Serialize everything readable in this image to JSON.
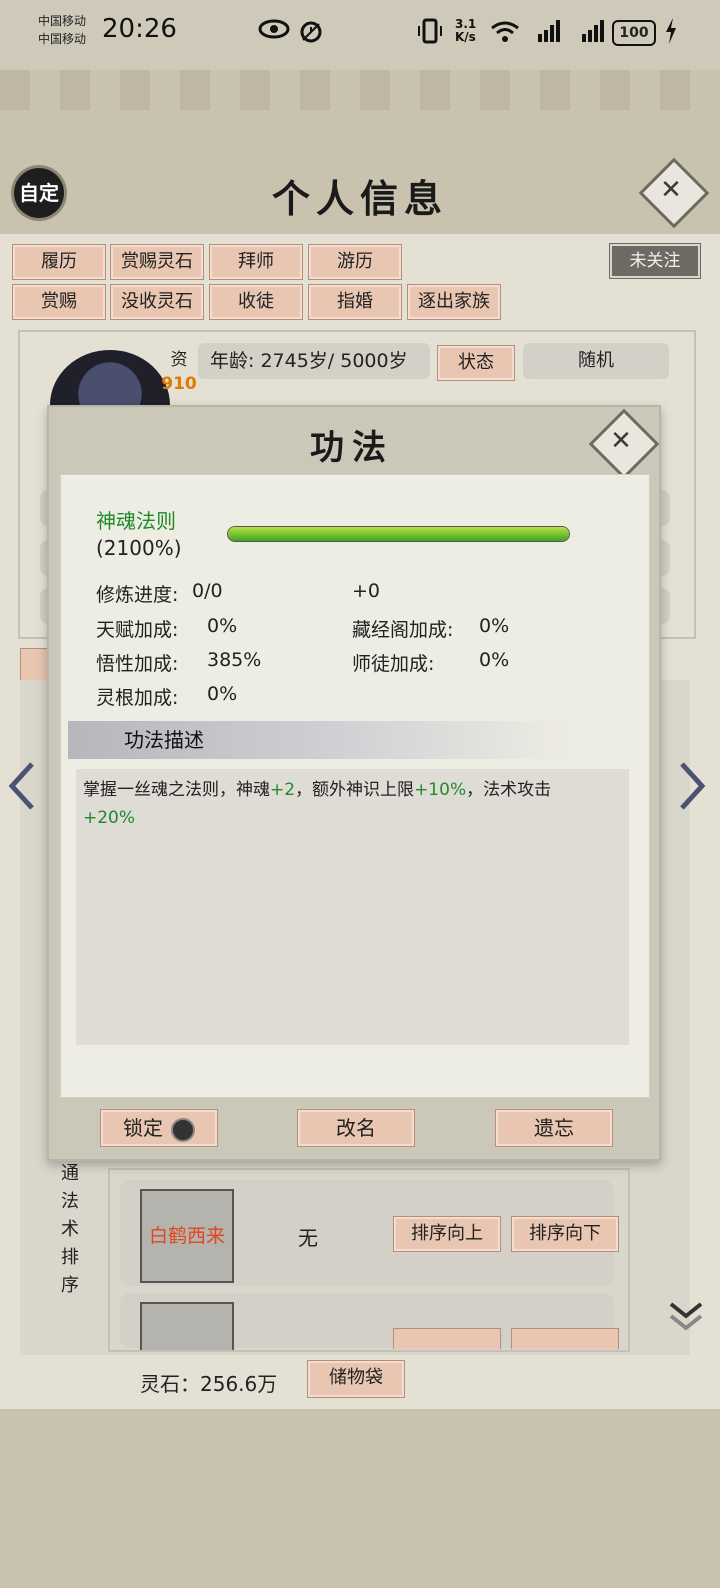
{
  "status_bar": {
    "carrier1": "中国移动",
    "carrier2": "中国移动",
    "time": "20:26",
    "net_speed_top": "3.1",
    "net_speed_unit": "K/s",
    "wifi_label": "6",
    "signal1_label": "4G",
    "signal2_label": "4G",
    "battery": "100"
  },
  "header": {
    "custom_button": "自定",
    "title": "个人信息"
  },
  "tabs_row1": [
    "履历",
    "赏赐灵石",
    "拜师",
    "游历"
  ],
  "tabs_row2": [
    "赏赐",
    "没收灵石",
    "收徒",
    "指婚",
    "逐出家族"
  ],
  "follow_button": "未关注",
  "profile": {
    "zi_label": "资",
    "zi_value": "910",
    "age": "年龄: 2745岁/ 5000岁",
    "state_button": "状态",
    "random_label": "随机"
  },
  "modal": {
    "title": "功法",
    "skill_name": "神魂法则",
    "skill_pct": "(2100%)",
    "progress_fraction": 1.0,
    "stats": {
      "cultivation_label": "修炼进度:",
      "cultivation_value": "0/0",
      "cultivation_bonus": "+0",
      "talent_label": "天赋加成:",
      "talent_value": "0%",
      "library_label": "藏经阁加成:",
      "library_value": "0%",
      "comprehension_label": "悟性加成:",
      "comprehension_value": "385%",
      "mentor_label": "师徒加成:",
      "mentor_value": "0%",
      "root_label": "灵根加成:",
      "root_value": "0%"
    },
    "desc_header": "功法描述",
    "desc_part1": "掌握一丝魂之法则，神魂",
    "desc_g1": "+2",
    "desc_part2": "，额外神识上限",
    "desc_g2": "+10%",
    "desc_part3": "，法术攻击",
    "desc_g3": "+20%",
    "buttons": {
      "lock": "锁定",
      "rename": "改名",
      "forget": "遗忘"
    }
  },
  "left_vertical_label": [
    "通",
    "法",
    "术",
    "排",
    "序"
  ],
  "slot1": {
    "name": "白鹤西来",
    "value": "无",
    "up": "排序向上",
    "down": "排序向下"
  },
  "bottom": {
    "stones": "灵石：256.6万",
    "bag_button": "储物袋"
  },
  "colors": {
    "accent_button": "#e8c6b2",
    "skill_green": "#1f8a2a",
    "slot_red": "#e0471e"
  }
}
